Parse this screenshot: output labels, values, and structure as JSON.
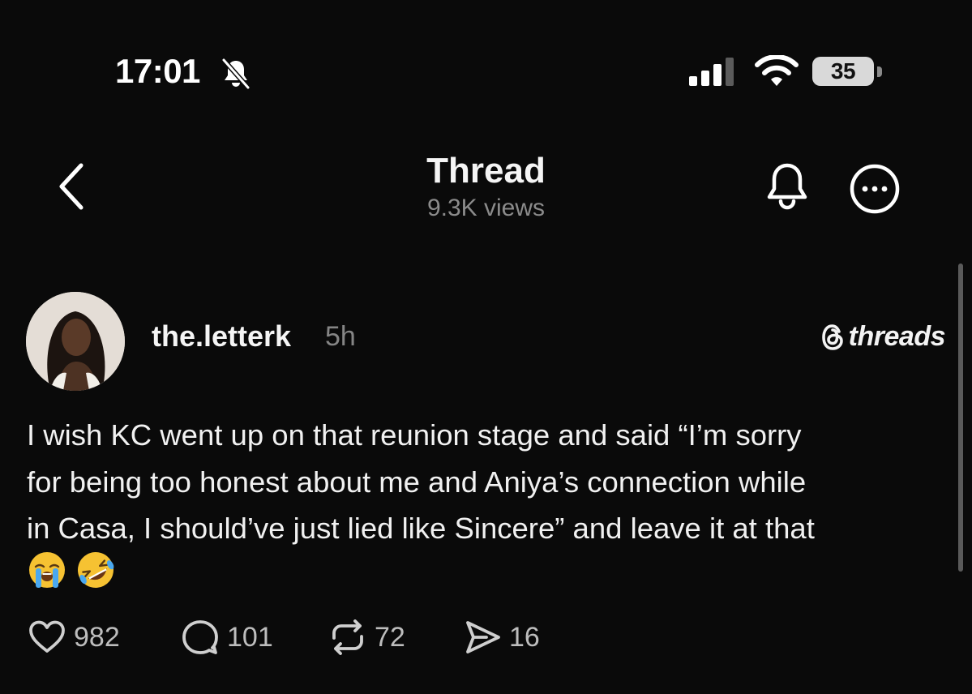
{
  "status_bar": {
    "time": "17:01",
    "battery": "35"
  },
  "header": {
    "title": "Thread",
    "views": "9.3K views"
  },
  "post": {
    "username": "the.letterk",
    "time_ago": "5h",
    "brand": "threads",
    "text": "I wish KC went up on that reunion stage and said “I’m sorry\nfor being too honest about me and Aniya’s connection while\nin Casa, I should’ve just lied like Sincere” and leave it at that",
    "emojis": [
      "loudly-crying-face",
      "rolling-on-floor-laughing"
    ]
  },
  "actions": {
    "likes": "982",
    "replies": "101",
    "reposts": "72",
    "shares": "16"
  },
  "colors": {
    "background": "#0a0a0a",
    "text": "#f1f1f1",
    "muted": "#858585"
  }
}
